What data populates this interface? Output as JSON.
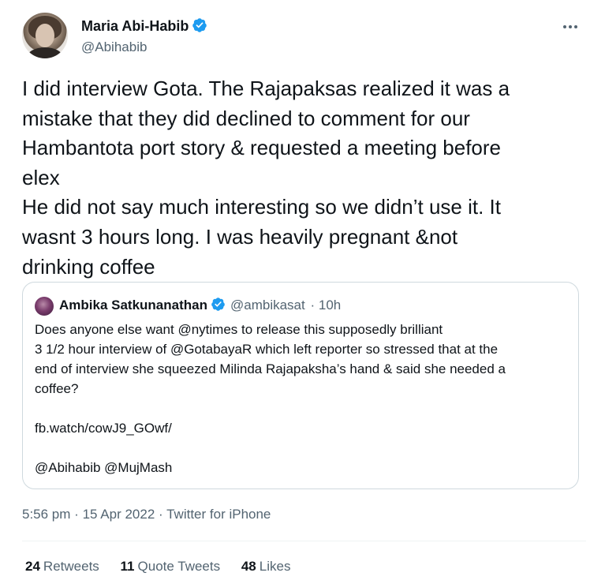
{
  "author": {
    "display_name": "Maria Abi-Habib",
    "handle": "@Abihabib",
    "verified": true
  },
  "tweet": {
    "lines": [
      "I did interview Gota. The Rajapaksas realized it was a",
      "mistake that they did declined to comment for our",
      "Hambantota port story & requested a meeting before",
      "elex",
      "He did not say much interesting so we didn’t use it. It",
      "wasnt 3 hours long. I was heavily pregnant &not",
      "drinking coffee"
    ]
  },
  "quoted": {
    "display_name": "Ambika Satkunanathan",
    "handle": "@ambikasat",
    "time": "· 10h",
    "verified": true,
    "lines": [
      "Does anyone else want @nytimes to release this supposedly brilliant",
      "3 1/2 hour interview of @GotabayaR which left reporter so stressed that at the",
      "end of interview she squeezed Milinda Rajapaksha’s hand & said she needed a",
      "coffee?",
      "",
      "fb.watch/cowJ9_GOwf/",
      "",
      "@Abihabib @MujMash"
    ]
  },
  "meta": {
    "time": "5:56 pm",
    "date": "15 Apr 2022",
    "source": "Twitter for iPhone",
    "separator": "·"
  },
  "stats": {
    "retweets": {
      "count": "24",
      "label": "Retweets"
    },
    "quotes": {
      "count": "11",
      "label": "Quote Tweets"
    },
    "likes": {
      "count": "48",
      "label": "Likes"
    }
  },
  "colors": {
    "verified": "#1d9bf0",
    "secondary_text": "#536471",
    "border": "#cfd9de"
  },
  "icons": {
    "verified": "verified-badge-icon",
    "more": "more-horizontal-icon"
  }
}
